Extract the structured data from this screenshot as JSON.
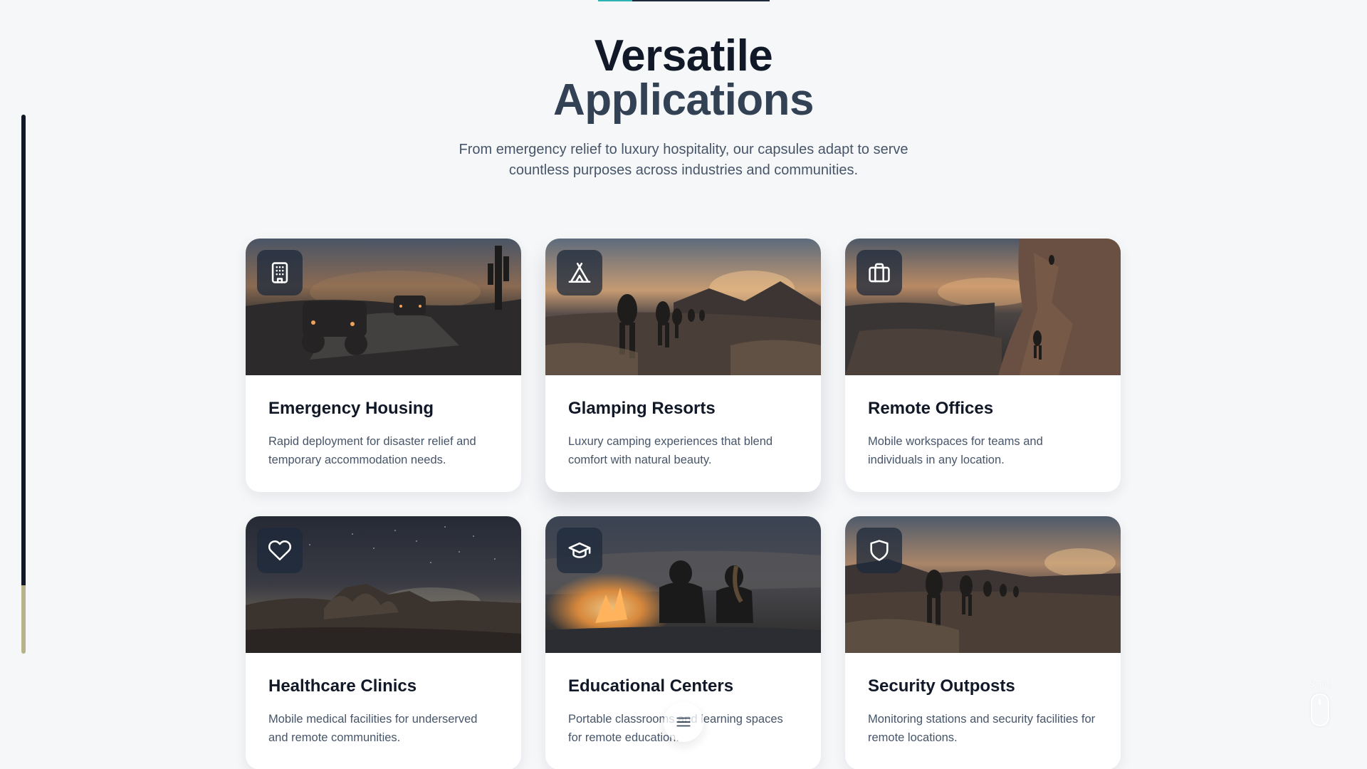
{
  "section": {
    "title_line1": "Versatile",
    "title_line2": "Applications",
    "subtitle": "From emergency relief to luxury hospitality, our capsules adapt to serve countless purposes across industries and communities."
  },
  "colors": {
    "accent_teal": "#2bb3b6",
    "rail_fill": "#111827",
    "rail_track": "#b8b48a",
    "heading_dark": "#111827",
    "heading_slate": "#334155"
  },
  "cards": [
    {
      "title": "Emergency Housing",
      "description": "Rapid deployment for disaster relief and temporary accommodation needs.",
      "icon": "building-icon",
      "image": "desert-offroad-vehicles-dusk"
    },
    {
      "title": "Glamping Resorts",
      "description": "Luxury camping experiences that blend comfort with natural beauty.",
      "icon": "tent-icon",
      "image": "hikers-desert-sunset"
    },
    {
      "title": "Remote Offices",
      "description": "Mobile workspaces for teams and individuals in any location.",
      "icon": "briefcase-icon",
      "image": "climbers-rock-face-sunset"
    },
    {
      "title": "Healthcare Clinics",
      "description": "Mobile medical facilities for underserved and remote communities.",
      "icon": "heart-icon",
      "image": "desert-rocks-starry-night"
    },
    {
      "title": "Educational Centers",
      "description": "Portable classrooms and learning spaces for remote education.",
      "icon": "graduation-cap-icon",
      "image": "campfire-couple-night"
    },
    {
      "title": "Security Outposts",
      "description": "Monitoring stations and security facilities for remote locations.",
      "icon": "shield-icon",
      "image": "hikers-desert-dusk"
    }
  ],
  "scroll_indicator": {
    "label": "Scroll"
  },
  "menu_button": {
    "icon": "menu-icon"
  }
}
